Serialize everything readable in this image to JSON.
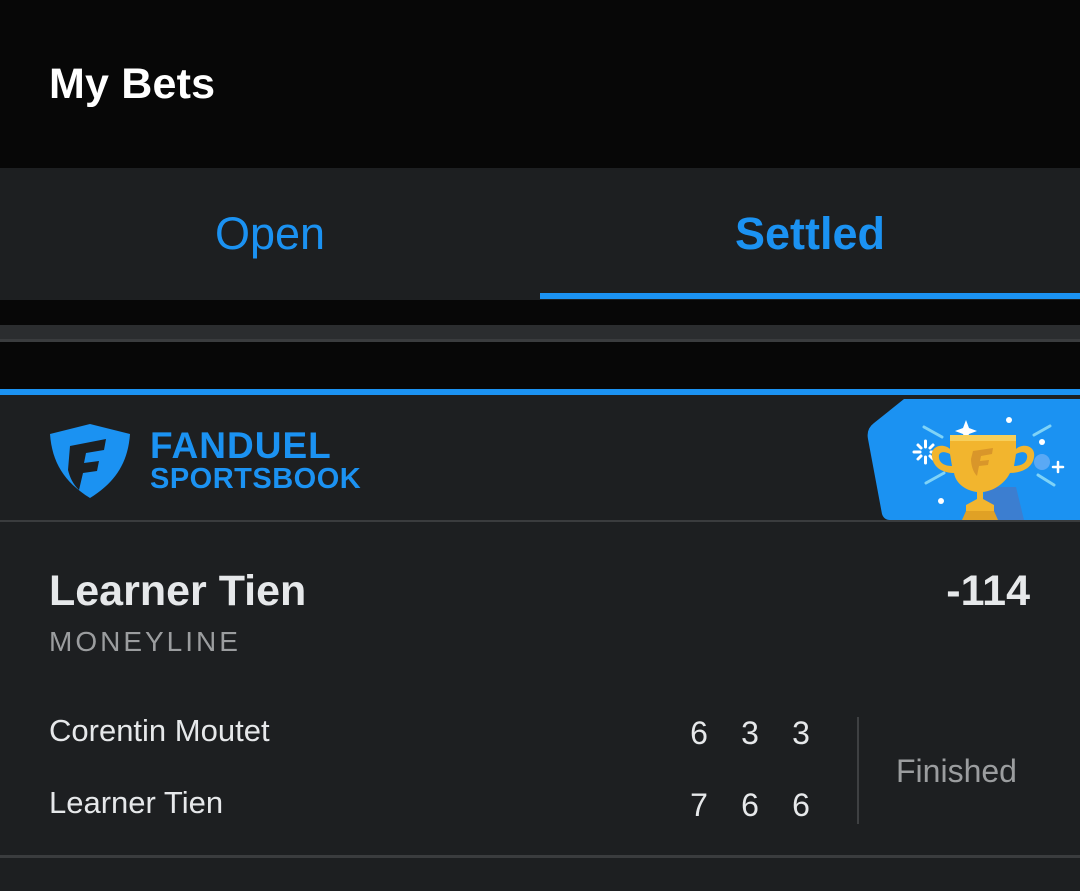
{
  "header": {
    "title": "My Bets"
  },
  "tabs": [
    {
      "label": "Open",
      "active": false
    },
    {
      "label": "Settled",
      "active": true
    }
  ],
  "colors": {
    "accent": "#1b92f2",
    "card": "#1d1f21",
    "background": "#070707",
    "trophy": "#f2b52e"
  },
  "card": {
    "brand": {
      "name": "FANDUEL",
      "sub": "SPORTSBOOK",
      "logo_icon": "fanduel-shield-icon"
    },
    "badge_icon": "trophy-icon",
    "selection": "Learner Tien",
    "odds": "-114",
    "bet_type": "MONEYLINE",
    "match": {
      "players": [
        {
          "name": "Corentin Moutet",
          "sets": [
            "6",
            "3",
            "3"
          ]
        },
        {
          "name": "Learner Tien",
          "sets": [
            "7",
            "6",
            "6"
          ]
        }
      ],
      "status": "Finished"
    }
  }
}
